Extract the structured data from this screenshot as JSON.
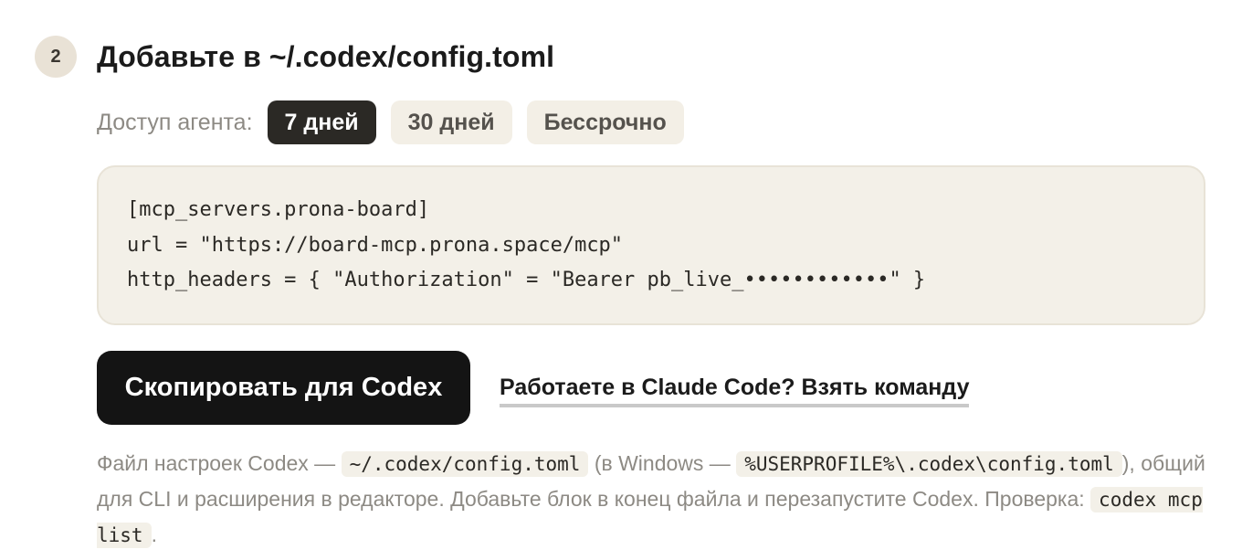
{
  "step": {
    "number": "2",
    "title": "Добавьте в ~/.codex/config.toml"
  },
  "access": {
    "label": "Доступ агента:",
    "options": [
      {
        "label": "7 дней",
        "selected": true
      },
      {
        "label": "30 дней",
        "selected": false
      },
      {
        "label": "Бессрочно",
        "selected": false
      }
    ]
  },
  "code": {
    "lines": [
      "[mcp_servers.prona-board]",
      "url = \"https://board-mcp.prona.space/mcp\"",
      "http_headers = { \"Authorization\" = \"Bearer pb_live_••••••••••••\" }"
    ]
  },
  "actions": {
    "copy_label": "Скопировать для Codex",
    "alt_link_label": "Работаете в Claude Code? Взять команду"
  },
  "note": {
    "part1": "Файл настроек Codex — ",
    "code1": "~/.codex/config.toml",
    "part2": " (в Windows — ",
    "code2": "%USERPROFILE%\\.codex\\config.toml",
    "part3": "), общий для CLI и расширения в редакторе. Добавьте блок в конец файла и перезапустите Codex. Проверка: ",
    "code3": "codex mcp list",
    "part4": "."
  },
  "colors": {
    "accent_dark": "#141414",
    "muted_text": "#8d8a84",
    "code_bg": "#f3f0e8",
    "badge_bg": "#e9e2d6"
  }
}
